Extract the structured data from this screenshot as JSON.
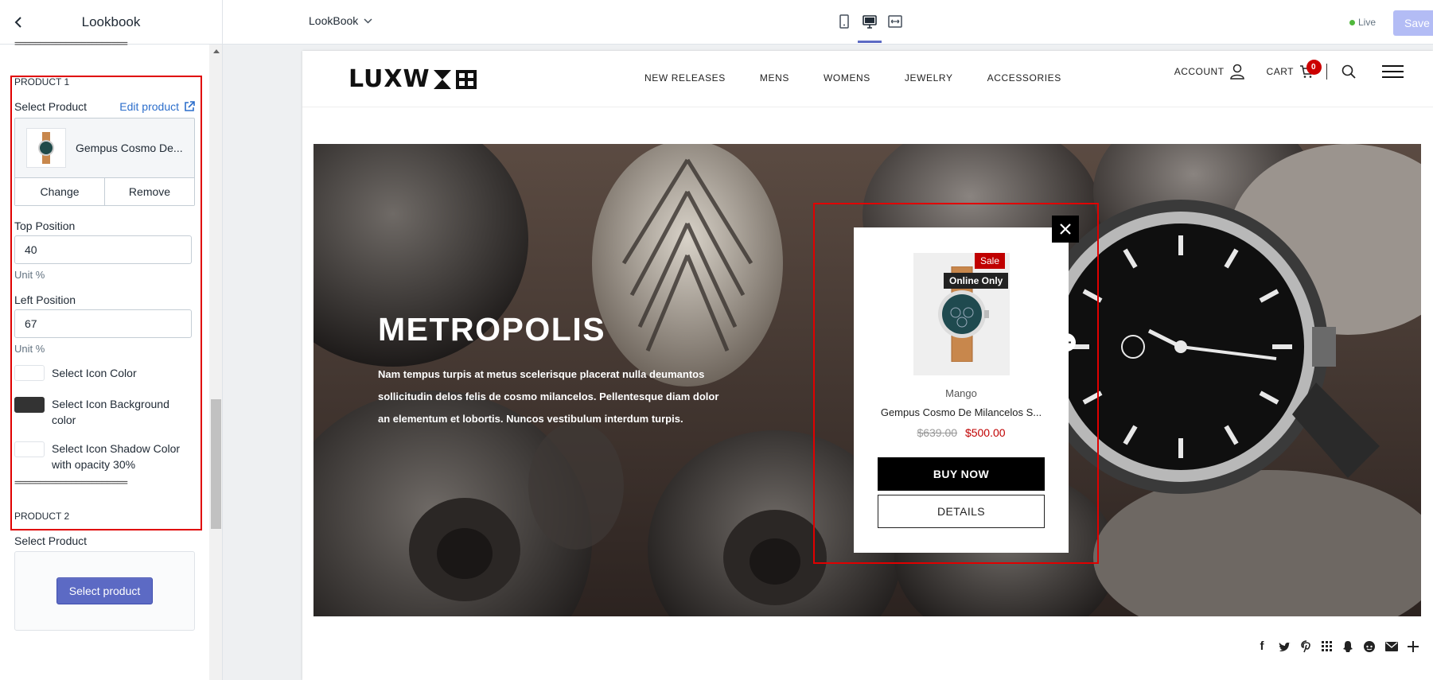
{
  "sidebar": {
    "title": "Lookbook",
    "divider": "======================",
    "product1": {
      "title": "PRODUCT 1",
      "select_label": "Select Product",
      "edit_link": "Edit product",
      "product_name": "Gempus Cosmo De...",
      "change": "Change",
      "remove": "Remove",
      "top_label": "Top Position",
      "top_value": "40",
      "top_unit": "Unit %",
      "left_label": "Left Position",
      "left_value": "67",
      "left_unit": "Unit %",
      "icon_color_label": "Select Icon Color",
      "icon_bg_label": "Select Icon Background color",
      "icon_shadow_label": "Select Icon Shadow Color with opacity 30%",
      "icon_color": "#ffffff",
      "icon_bg_color": "#333333",
      "icon_shadow_color": "#ffffff"
    },
    "product2": {
      "title": "PRODUCT 2",
      "select_label": "Select Product",
      "select_button": "Select product"
    }
  },
  "topbar": {
    "page_selector": "LookBook",
    "status": "Live",
    "save": "Save",
    "active_device": "desktop"
  },
  "site": {
    "logo": "LUXW",
    "nav": [
      "NEW RELEASES",
      "MENS",
      "WOMENS",
      "JEWELRY",
      "ACCESSORIES"
    ],
    "account": "ACCOUNT",
    "cart": "CART",
    "cart_count": "0"
  },
  "hero": {
    "title": "METROPOLIS",
    "description": "Nam tempus turpis at metus scelerisque placerat nulla deumantos sollicitudin delos felis de cosmo milancelos. Pellentesque diam dolor an elementum et lobortis. Nuncos vestibulum interdum turpis."
  },
  "popup": {
    "badge_sale": "Sale",
    "badge_online": "Online Only",
    "vendor": "Mango",
    "name": "Gempus Cosmo De Milancelos S...",
    "price_old": "$639.00",
    "price_new": "$500.00",
    "buy_now": "BUY NOW",
    "details": "DETAILS"
  },
  "colors": {
    "accent": "#5c6ac4",
    "highlight": "#e00000",
    "sale": "#c00000"
  }
}
